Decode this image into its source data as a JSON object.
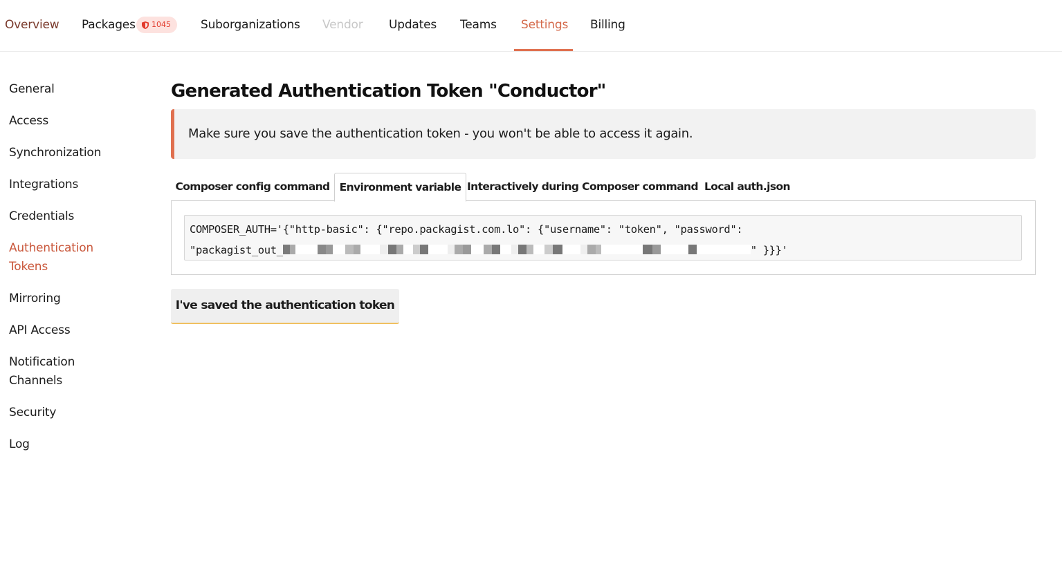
{
  "topnav": {
    "items": [
      {
        "label": "Overview",
        "state": "normal"
      },
      {
        "label": "Packages",
        "state": "normal",
        "badge": {
          "icon": "shield-icon",
          "count": "1045"
        }
      },
      {
        "label": "Suborganizations",
        "state": "normal"
      },
      {
        "label": "Vendor",
        "state": "disabled"
      },
      {
        "label": "Updates",
        "state": "normal"
      },
      {
        "label": "Teams",
        "state": "normal"
      },
      {
        "label": "Settings",
        "state": "active"
      },
      {
        "label": "Billing",
        "state": "normal"
      }
    ]
  },
  "sidebar": {
    "items": [
      {
        "label": "General"
      },
      {
        "label": "Access"
      },
      {
        "label": "Synchronization"
      },
      {
        "label": "Integrations"
      },
      {
        "label": "Credentials"
      },
      {
        "label": "Authentication Tokens",
        "active": true
      },
      {
        "label": "Mirroring"
      },
      {
        "label": "API Access"
      },
      {
        "label": "Notification Channels"
      },
      {
        "label": "Security"
      },
      {
        "label": "Log"
      }
    ]
  },
  "main": {
    "title": "Generated Authentication Token \"Conductor\"",
    "alert": "Make sure you save the authentication token - you won't be able to access it again.",
    "tabs": [
      {
        "label": "Composer config command"
      },
      {
        "label": "Environment variable",
        "active": true
      },
      {
        "label": "Interactively during Composer command"
      },
      {
        "label": "Local auth.json"
      }
    ],
    "code": {
      "line1": "COMPOSER_AUTH='{\"http-basic\": {\"repo.packagist.com.lo\": {\"username\": \"token\", \"password\":",
      "line2_prefix": "\"packagist_out_",
      "line2_redacted": "[redacted token]",
      "line2_suffix": "\" }}}'"
    },
    "confirm_button": "I've saved the authentication token"
  },
  "colors": {
    "accent": "#e0704f",
    "active_text": "#c9573b",
    "badge_bg": "#fde2df",
    "badge_text": "#e23a2c",
    "button_underline": "#f0c060"
  }
}
